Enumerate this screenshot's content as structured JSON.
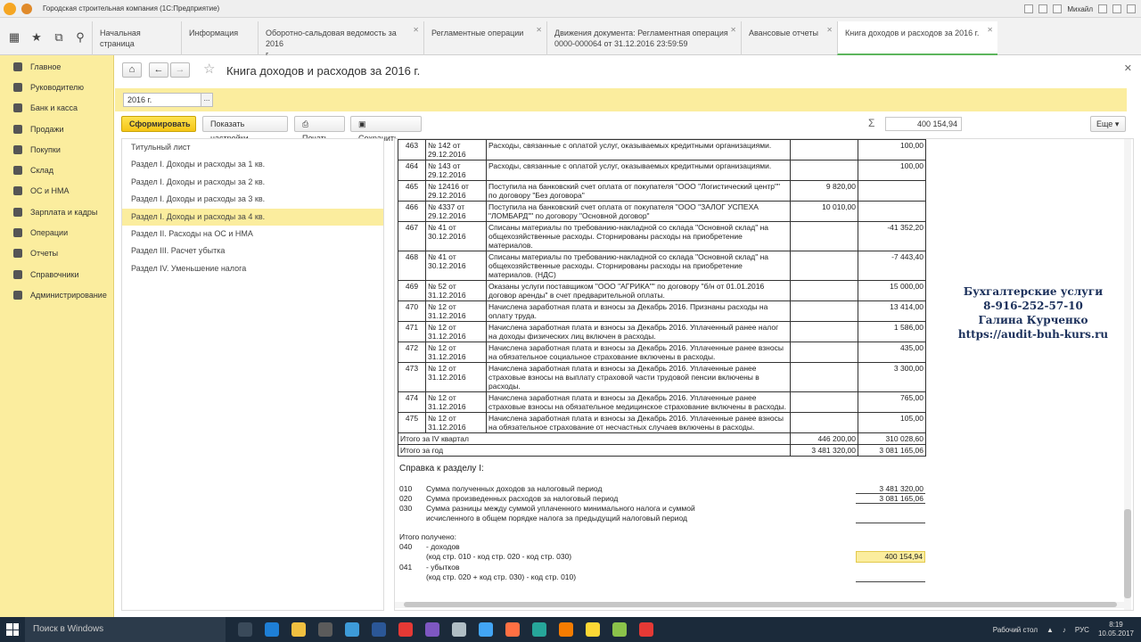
{
  "window": {
    "title": "Городская строительная компания (1С:Предприятие)",
    "user": "Михайл"
  },
  "tabs": [
    {
      "label": "Начальная страница",
      "sub": ""
    },
    {
      "label": "Информация",
      "sub": ""
    },
    {
      "label": "Оборотно-сальдовая ведомость за 2016",
      "sub": "г."
    },
    {
      "label": "Регламентные операции",
      "sub": ""
    },
    {
      "label": "Движения документа: Регламентная операция",
      "sub": "0000-000064 от 31.12.2016 23:59:59"
    },
    {
      "label": "Авансовые отчеты",
      "sub": ""
    },
    {
      "label": "Книга доходов и расходов за 2016 г.",
      "sub": ""
    }
  ],
  "nav": [
    {
      "label": "Главное",
      "icon": "menu-icon"
    },
    {
      "label": "Руководителю",
      "icon": "chart-icon"
    },
    {
      "label": "Банк и касса",
      "icon": "bank-icon"
    },
    {
      "label": "Продажи",
      "icon": "cart-icon"
    },
    {
      "label": "Покупки",
      "icon": "basket-icon"
    },
    {
      "label": "Склад",
      "icon": "warehouse-icon"
    },
    {
      "label": "ОС и НМА",
      "icon": "truck-icon"
    },
    {
      "label": "Зарплата и кадры",
      "icon": "people-icon"
    },
    {
      "label": "Операции",
      "icon": "operations-icon"
    },
    {
      "label": "Отчеты",
      "icon": "report-icon"
    },
    {
      "label": "Справочники",
      "icon": "book-icon"
    },
    {
      "label": "Администрирование",
      "icon": "gear-icon"
    }
  ],
  "doc": {
    "title": "Книга доходов и расходов за 2016 г.",
    "period": "2016 г.",
    "period_btn": "...",
    "form_btn": "Сформировать",
    "settings_btn": "Показать настройки",
    "print_btn": "Печать",
    "save_btn": "Сохранить...",
    "sum_label": "Σ",
    "sum_value": "400 154,94",
    "more_btn": "Еще"
  },
  "sections": [
    "Титульный лист",
    "Раздел I. Доходы и расходы за 1 кв.",
    "Раздел I. Доходы и расходы за 2 кв.",
    "Раздел I. Доходы и расходы за 3 кв.",
    "Раздел I. Доходы и расходы за 4 кв.",
    "Раздел II. Расходы на ОС и НМА",
    "Раздел III. Расчет убытка",
    "Раздел IV. Уменьшение налога"
  ],
  "rows": [
    {
      "n": "463",
      "doc": "№ 142 от 29.12.2016",
      "desc": "Расходы, связанные с оплатой услуг, оказываемых кредитными организациями.",
      "income": "",
      "expense": "100,00"
    },
    {
      "n": "464",
      "doc": "№ 143 от 29.12.2016",
      "desc": "Расходы, связанные с оплатой услуг, оказываемых кредитными организациями.",
      "income": "",
      "expense": "100,00"
    },
    {
      "n": "465",
      "doc": "№ 12416 от 29.12.2016",
      "desc": "Поступила на банковский счет оплата от покупателя \"ООО \"Логистический центр\"\" по договору \"Без договора\"",
      "income": "9 820,00",
      "expense": ""
    },
    {
      "n": "466",
      "doc": "№ 4337 от 29.12.2016",
      "desc": "Поступила на банковский счет оплата от покупателя \"ООО \"ЗАЛОГ УСПЕХА \"ЛОМБАРД\"\" по договору \"Основной договор\"",
      "income": "10 010,00",
      "expense": ""
    },
    {
      "n": "467",
      "doc": "№ 41 от 30.12.2016",
      "desc": "Списаны материалы по требованию-накладной со склада \"Основной склад\" на общехозяйственные расходы. Сторнированы расходы на приобретение материалов.",
      "income": "",
      "expense": "-41 352,20"
    },
    {
      "n": "468",
      "doc": "№ 41 от 30.12.2016",
      "desc": "Списаны материалы по требованию-накладной со склада \"Основной склад\" на общехозяйственные расходы. Сторнированы расходы на приобретение материалов. (НДС)",
      "income": "",
      "expense": "-7 443,40"
    },
    {
      "n": "469",
      "doc": "№ 52 от 31.12.2016",
      "desc": "Оказаны услуги поставщиком \"ООО \"АГРИКА\"\" по договору \"б/н от 01.01.2016 договор аренды\" в счет предварительной оплаты.",
      "income": "",
      "expense": "15 000,00"
    },
    {
      "n": "470",
      "doc": "№ 12 от 31.12.2016",
      "desc": "Начислена заработная плата и взносы за Декабрь 2016. Признаны расходы на оплату труда.",
      "income": "",
      "expense": "13 414,00"
    },
    {
      "n": "471",
      "doc": "№ 12 от 31.12.2016",
      "desc": "Начислена заработная плата и взносы за Декабрь 2016. Уплаченный ранее налог на доходы физических лиц включен в расходы.",
      "income": "",
      "expense": "1 586,00"
    },
    {
      "n": "472",
      "doc": "№ 12 от 31.12.2016",
      "desc": "Начислена заработная плата и взносы за Декабрь 2016. Уплаченные ранее взносы на обязательное социальное страхование включены в расходы.",
      "income": "",
      "expense": "435,00"
    },
    {
      "n": "473",
      "doc": "№ 12 от 31.12.2016",
      "desc": "Начислена заработная плата и взносы за Декабрь 2016. Уплаченные ранее страховые взносы на выплату страховой части трудовой пенсии включены в расходы.",
      "income": "",
      "expense": "3 300,00"
    },
    {
      "n": "474",
      "doc": "№ 12 от 31.12.2016",
      "desc": "Начислена заработная плата и взносы за Декабрь 2016. Уплаченные ранее страховые взносы на обязательное медицинское страхование включены в расходы.",
      "income": "",
      "expense": "765,00"
    },
    {
      "n": "475",
      "doc": "№ 12 от 31.12.2016",
      "desc": "Начислена заработная плата и взносы за Декабрь 2016. Уплаченные ранее взносы на обязательное страхование от несчастных случаев включены в расходы.",
      "income": "",
      "expense": "105,00"
    }
  ],
  "totals": [
    {
      "label": "Итого за IV квартал",
      "income": "446 200,00",
      "expense": "310 028,60"
    },
    {
      "label": "Итого за год",
      "income": "3 481 320,00",
      "expense": "3 081 165,06"
    }
  ],
  "summary": {
    "title": "Справка к разделу I:",
    "l010": {
      "code": "010",
      "text": "Сумма полученных доходов за налоговый период",
      "value": "3 481 320,00"
    },
    "l020": {
      "code": "020",
      "text": "Сумма произведенных расходов за налоговый период",
      "value": "3 081 165,06"
    },
    "l030": {
      "code": "030",
      "text": "Сумма разницы между суммой уплаченного минимального налога и суммой",
      "text2": "исчисленного в общем порядке налога за предыдущий налоговый период",
      "value": ""
    },
    "total_label": "Итого получено:",
    "l040": {
      "code": "040",
      "text": "- доходов",
      "text2": "(код стр. 010 - код стр. 020 - код стр. 030)",
      "value": "400 154,94"
    },
    "l041": {
      "code": "041",
      "text": "- убытков",
      "text2": "(код стр. 020 + код стр. 030) - код стр. 010)",
      "value": ""
    }
  },
  "promo": {
    "line1": "Бухгалтерские услуги",
    "line2": "8-916-252-57-10",
    "line3": "Галина Курченко",
    "line4": "https://audit-buh-kurs.ru"
  },
  "taskbar": {
    "search": "Поиск в Windows",
    "desktop": "Рабочий стол",
    "lang": "РУС",
    "time": "8:19",
    "date": "10.05.2017"
  }
}
